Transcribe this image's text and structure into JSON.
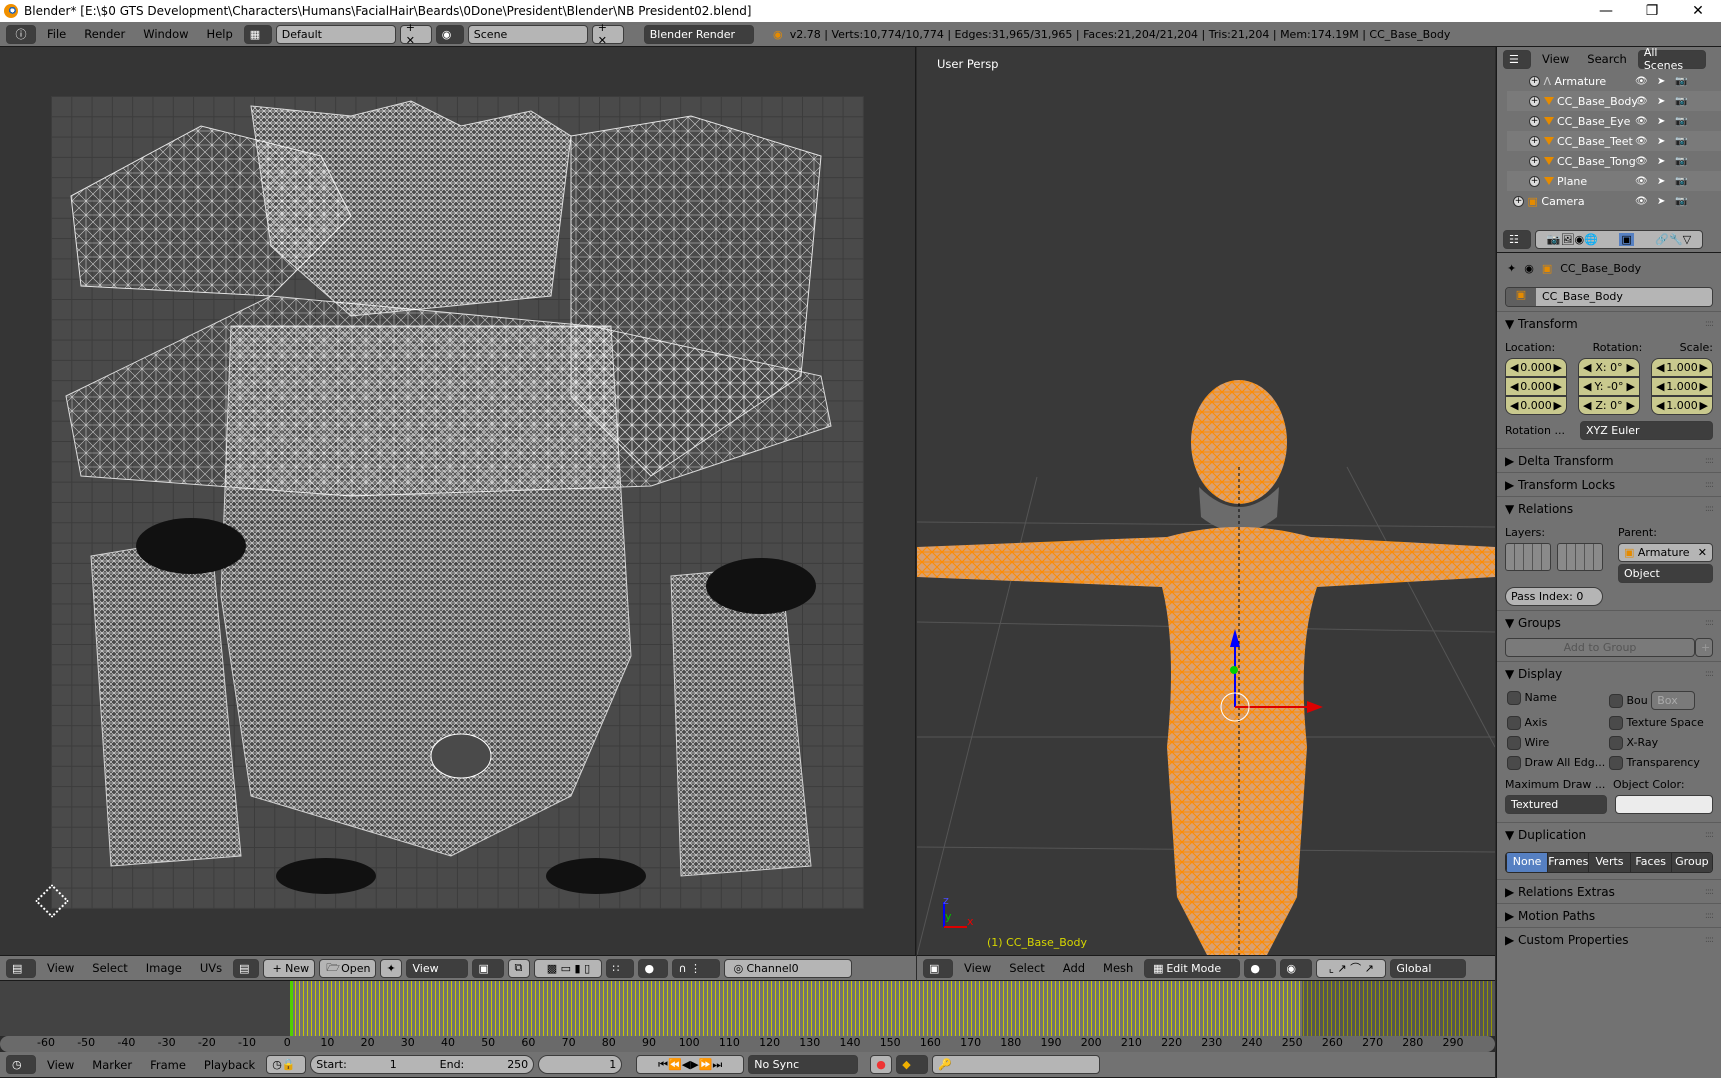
{
  "window": {
    "title": "Blender* [E:\\$0 GTS Development\\Characters\\Humans\\FacialHair\\Beards\\0Done\\President\\Blender\\NB President02.blend]",
    "controls": [
      "minimize-icon",
      "restore-icon",
      "close-icon"
    ]
  },
  "info_header": {
    "menus": [
      "File",
      "Render",
      "Window",
      "Help"
    ],
    "screen_layout": "Default",
    "scene": "Scene",
    "render_engine": "Blender Render",
    "stats": "v2.78 | Verts:10,774/10,774 | Edges:31,965/31,965 | Faces:21,204/21,204 | Tris:21,204 | Mem:174.19M | CC_Base_Body"
  },
  "uv_editor": {
    "menus": [
      "View",
      "Select",
      "Image",
      "UVs"
    ],
    "new_label": "New",
    "open_label": "Open",
    "view_label": "View",
    "channel": "Channel0"
  },
  "viewport": {
    "view_label": "User Persp",
    "object_label": "(1) CC_Base_Body",
    "axis_labels": {
      "x": "x",
      "y": "y",
      "z": "z"
    },
    "menus": [
      "View",
      "Select",
      "Add",
      "Mesh"
    ],
    "mode": "Edit Mode",
    "orientation": "Global",
    "colors": {
      "selection": "#ff8c00",
      "text_object": "#d6d600"
    }
  },
  "outliner": {
    "tabs": [
      "View",
      "Search"
    ],
    "scene_filter": "All Scenes",
    "items": [
      {
        "name": "Armature",
        "type": "armature",
        "indent": 2
      },
      {
        "name": "CC_Base_Body",
        "type": "mesh",
        "indent": 2,
        "active": true
      },
      {
        "name": "CC_Base_Eye",
        "type": "mesh",
        "indent": 2
      },
      {
        "name": "CC_Base_Teet",
        "type": "mesh",
        "indent": 2
      },
      {
        "name": "CC_Base_Tong",
        "type": "mesh",
        "indent": 2
      },
      {
        "name": "Plane",
        "type": "mesh",
        "indent": 2
      },
      {
        "name": "Camera",
        "type": "camera",
        "indent": 1
      }
    ]
  },
  "properties": {
    "breadcrumb_object": "CC_Base_Body",
    "object_name": "CC_Base_Body",
    "transform": {
      "title": "Transform",
      "location_label": "Location:",
      "rotation_label": "Rotation:",
      "scale_label": "Scale:",
      "location": [
        "0.000",
        "0.000",
        "0.000"
      ],
      "rotation": [
        "X:   0°",
        "Y:  -0°",
        "Z:   0°"
      ],
      "scale": [
        "1.000",
        "1.000",
        "1.000"
      ],
      "rotation_mode_label": "Rotation ...",
      "rotation_mode": "XYZ Euler"
    },
    "delta_transform": "Delta Transform",
    "transform_locks": "Transform Locks",
    "relations": {
      "title": "Relations",
      "layers_label": "Layers:",
      "parent_label": "Parent:",
      "parent": "Armature",
      "parent_type": "Object",
      "pass_index": "Pass Index:   0"
    },
    "groups": {
      "title": "Groups",
      "add_label": "Add to Group"
    },
    "display": {
      "title": "Display",
      "left": [
        "Name",
        "Axis",
        "Wire",
        "Draw All Edg..."
      ],
      "right": [
        "Bou",
        "Texture Space",
        "X-Ray",
        "Transparency"
      ],
      "bounds_type": "Box",
      "max_draw_label": "Maximum Draw ...",
      "object_color_label": "Object Color:",
      "max_draw": "Textured"
    },
    "duplication": {
      "title": "Duplication",
      "options": [
        "None",
        "Frames",
        "Verts",
        "Faces",
        "Group"
      ],
      "active": "None"
    },
    "collapsed": [
      "Relations Extras",
      "Motion Paths",
      "Custom Properties"
    ]
  },
  "timeline": {
    "ruler": [
      "-60",
      "-50",
      "-40",
      "-30",
      "-20",
      "-10",
      "0",
      "10",
      "20",
      "30",
      "40",
      "50",
      "60",
      "70",
      "80",
      "90",
      "100",
      "110",
      "120",
      "130",
      "140",
      "150",
      "160",
      "170",
      "180",
      "190",
      "200",
      "210",
      "220",
      "230",
      "240",
      "250",
      "260",
      "270",
      "280",
      "290"
    ],
    "menus": [
      "View",
      "Marker",
      "Frame",
      "Playback"
    ],
    "start_label": "Start:",
    "start": "1",
    "end_label": "End:",
    "end": "250",
    "current_frame": "1",
    "sync": "No Sync"
  }
}
